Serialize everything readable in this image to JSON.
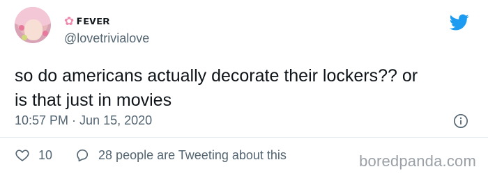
{
  "author": {
    "display_name": "ꜰᴇᴠᴇʀ",
    "handle": "@lovetrivialove",
    "decoration": "✿"
  },
  "tweet": {
    "text_line1": "so do americans actually decorate their lockers?? or",
    "text_line2": "is that just in movies",
    "timestamp": "10:57 PM · Jun 15, 2020"
  },
  "actions": {
    "likes": "10",
    "tweeting": "28 people are Tweeting about this"
  },
  "watermark": "boredpanda.com",
  "colors": {
    "twitter_blue": "#1d9bf0",
    "secondary_text": "#536471",
    "primary_text": "#0f1419"
  },
  "icons": [
    "twitter-bird-icon",
    "info-icon",
    "heart-icon",
    "speech-bubble-icon"
  ]
}
